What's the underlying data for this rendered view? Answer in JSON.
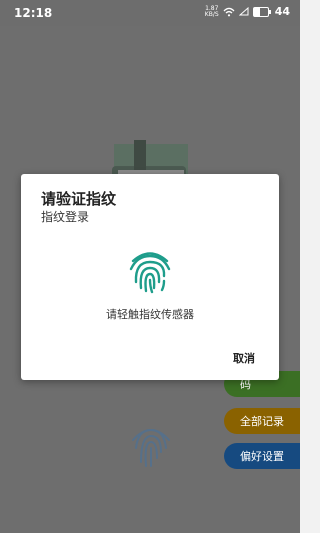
{
  "status_bar": {
    "time": "12:18",
    "net_speed_value": "1.87",
    "net_speed_unit": "KB/S",
    "battery_level": "44",
    "battery_fill_percent": 44
  },
  "background": {
    "buttons": [
      {
        "label": "码",
        "color": "#3b6f24"
      },
      {
        "label": "全部记录",
        "color": "#8a6200"
      },
      {
        "label": "偏好设置",
        "color": "#164a80"
      }
    ]
  },
  "dialog": {
    "title": "请验证指纹",
    "subtitle": "指纹登录",
    "hint": "请轻触指纹传感器",
    "cancel_label": "取消",
    "accent_color": "#1e9d8b"
  }
}
